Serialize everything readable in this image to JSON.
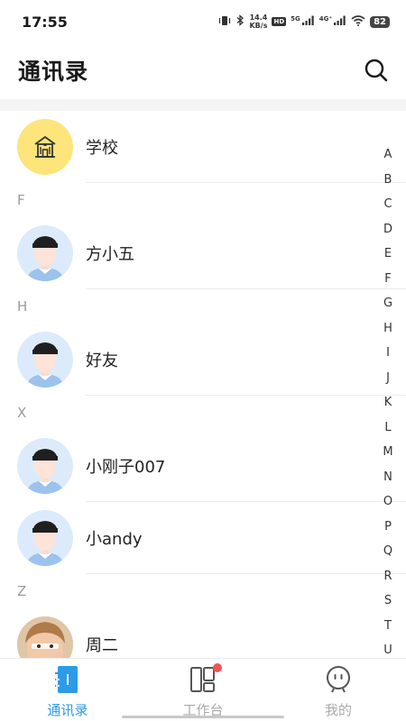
{
  "status_bar": {
    "time": "17:55",
    "net_speed_value": "14.4",
    "net_speed_unit": "KB/s",
    "hd_badge": "HD",
    "signal_1_label": "5G",
    "signal_2_label": "4G⁺",
    "battery": "82"
  },
  "header": {
    "title": "通讯录"
  },
  "contacts": {
    "school": {
      "name": "学校",
      "icon": "school-building-icon"
    },
    "section_f": "F",
    "fang": {
      "name": "方小五",
      "icon": "boy-avatar"
    },
    "section_h": "H",
    "haoyou": {
      "name": "好友",
      "icon": "boy-avatar"
    },
    "section_x": "X",
    "xiaogang": {
      "name": "小刚子007",
      "icon": "boy-avatar"
    },
    "xiaoandy": {
      "name": "小andy",
      "icon": "boy-avatar"
    },
    "section_z": "Z",
    "zhouer": {
      "name": "周二",
      "icon": "child-photo-avatar"
    }
  },
  "index_bar": {
    "letters": [
      "A",
      "B",
      "C",
      "D",
      "E",
      "F",
      "G",
      "H",
      "I",
      "J",
      "K",
      "L",
      "M",
      "N",
      "O",
      "P",
      "Q",
      "R",
      "S",
      "T",
      "U"
    ]
  },
  "tab_bar": {
    "contacts_label": "通讯录",
    "workbench_label": "工作台",
    "mine_label": "我的",
    "active_color": "#2c9be8",
    "inactive_color": "#aaaaaa",
    "badge_color": "#f25454"
  }
}
